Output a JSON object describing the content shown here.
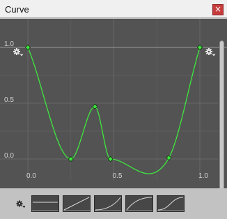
{
  "window": {
    "title": "Curve",
    "close_glyph": "×",
    "close_color": "#c63c3c"
  },
  "curve_editor": {
    "background_color": "#535353",
    "curve_color": "#3fe63f",
    "x_tick_labels": [
      "0.0",
      "0.5",
      "1.0"
    ],
    "y_tick_labels": [
      "1.0",
      "0.5",
      "0.0"
    ],
    "keyframes": [
      {
        "time": 0.0,
        "value": 1.0
      },
      {
        "time": 0.25,
        "value": 0.0
      },
      {
        "time": 0.39,
        "value": 0.47
      },
      {
        "time": 0.48,
        "value": 0.0
      },
      {
        "time": 0.82,
        "value": 0.01
      },
      {
        "time": 1.0,
        "value": 1.0
      }
    ],
    "left_gear_icon": "gear-dropdown-icon",
    "right_gear_icon": "gear-dropdown-icon"
  },
  "presets": {
    "gear_icon": "gear-dropdown-icon",
    "items": [
      {
        "name": "constant",
        "icon": "preset-constant-icon"
      },
      {
        "name": "linear",
        "icon": "preset-linear-icon"
      },
      {
        "name": "ease-in",
        "icon": "preset-ease-in-icon"
      },
      {
        "name": "ease-out",
        "icon": "preset-ease-out-icon"
      },
      {
        "name": "ease-in-out",
        "icon": "preset-ease-in-out-icon"
      }
    ]
  }
}
